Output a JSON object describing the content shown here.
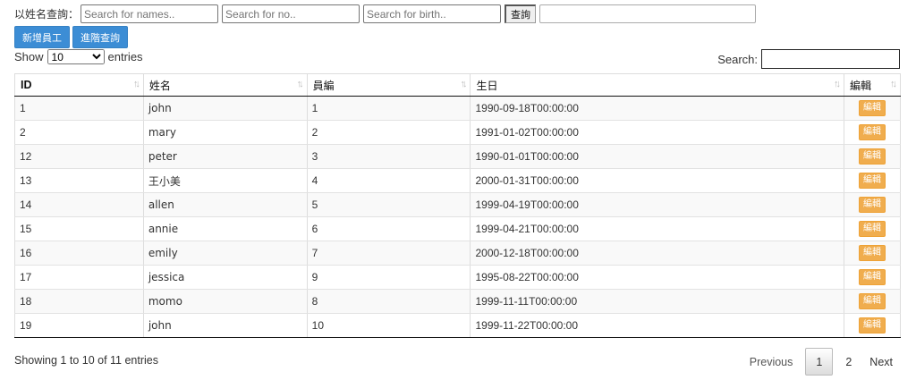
{
  "filters": {
    "label": "以姓名查詢：",
    "name_placeholder": "Search for names..",
    "no_placeholder": "Search for no..",
    "birth_placeholder": "Search for birth..",
    "query_label": "查詢",
    "extra_value": ""
  },
  "actions": {
    "add_label": "新增員工",
    "advanced_label": "進階查詢"
  },
  "length": {
    "show_label": "Show",
    "selected": "10",
    "entries_label": "entries"
  },
  "search": {
    "label": "Search:",
    "value": ""
  },
  "table": {
    "headers": [
      "ID",
      "姓名",
      "員編",
      "生日",
      "編輯"
    ],
    "edit_label": "編輯",
    "rows": [
      [
        "1",
        "john",
        "1",
        "1990-09-18T00:00:00"
      ],
      [
        "2",
        "mary",
        "2",
        "1991-01-02T00:00:00"
      ],
      [
        "12",
        "peter",
        "3",
        "1990-01-01T00:00:00"
      ],
      [
        "13",
        "王小美",
        "4",
        "2000-01-31T00:00:00"
      ],
      [
        "14",
        "allen",
        "5",
        "1999-04-19T00:00:00"
      ],
      [
        "15",
        "annie",
        "6",
        "1999-04-21T00:00:00"
      ],
      [
        "16",
        "emily",
        "7",
        "2000-12-18T00:00:00"
      ],
      [
        "17",
        "jessica",
        "9",
        "1995-08-22T00:00:00"
      ],
      [
        "18",
        "momo",
        "8",
        "1999-11-11T00:00:00"
      ],
      [
        "19",
        "john",
        "10",
        "1999-11-22T00:00:00"
      ]
    ]
  },
  "info": "Showing 1 to 10 of 11 entries",
  "pagination": {
    "previous": "Previous",
    "pages": [
      "1",
      "2"
    ],
    "current": "1",
    "next": "Next"
  },
  "icons": {
    "sort": "sort-both-icon"
  },
  "colors": {
    "primary": "#3c8dd5",
    "warning": "#f0ad4e"
  }
}
